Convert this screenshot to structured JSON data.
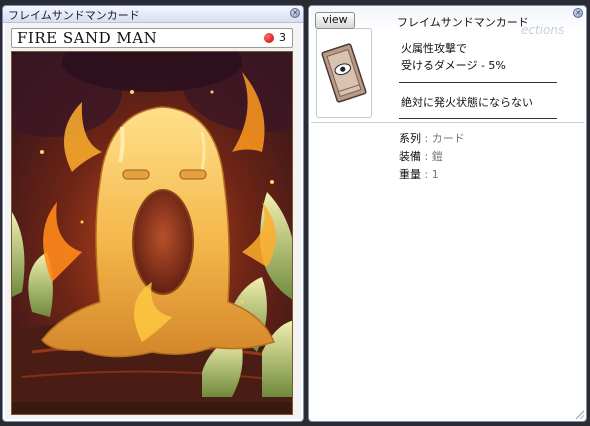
{
  "card_window": {
    "title": "フレイムサンドマンカード",
    "card_name": "FIRE SAND MAN",
    "slot_count": "3",
    "close_icon": "close-icon"
  },
  "info_window": {
    "view_button": "view",
    "title": "フレイムサンドマンカード",
    "watermark": "ections",
    "description": [
      "火属性攻撃で",
      "受けるダメージ - 5%",
      "絶対に発火状態にならない"
    ],
    "attributes": [
      {
        "key": "系列",
        "sep": " : ",
        "value": "カード"
      },
      {
        "key": "装備",
        "sep": " : ",
        "value": "鎧"
      },
      {
        "key": "重量",
        "sep": " : ",
        "value": "1"
      }
    ],
    "close_icon": "close-icon"
  },
  "colors": {
    "titlebar": "#d7def0",
    "border": "#7d8db3",
    "slot_dot": "#d40000",
    "sand": "#f2b94a",
    "fire": "#ff8a1a"
  }
}
